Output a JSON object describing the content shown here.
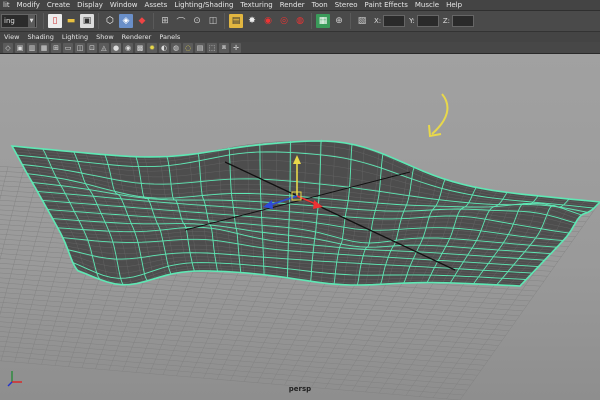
{
  "menubar": {
    "items": [
      "lit",
      "Modify",
      "Create",
      "Display",
      "Window",
      "Assets",
      "Lighting/Shading",
      "Texturing",
      "Render",
      "Toon",
      "Stereo",
      "Paint Effects",
      "Muscle",
      "Help"
    ]
  },
  "shelf": {
    "mode_value": "ing",
    "axis_labels": [
      "X:",
      "Y:",
      "Z:"
    ]
  },
  "panel_menu": {
    "items": [
      "View",
      "Shading",
      "Lighting",
      "Show",
      "Renderer",
      "Panels"
    ]
  },
  "viewport": {
    "camera_label": "persp",
    "background_color": "#9e9e9e",
    "wireframe_color": "#5ee8b4",
    "surface_color": "#4a4a4a",
    "annotation_arrow_color": "#e8d84a"
  },
  "icons": {
    "menubar": [],
    "shelf": [
      "new-scene-icon",
      "open-scene-icon",
      "save-scene-icon",
      "select-by-hierarchy-icon",
      "select-object-icon",
      "select-component-icon",
      "snap-grid-icon",
      "snap-curve-icon",
      "snap-point-icon",
      "snap-view-plane-icon",
      "history-icon",
      "render-icon",
      "ipr-render-icon",
      "render-settings-icon",
      "attribute-editor-icon",
      "tool-settings-icon",
      "channel-box-icon"
    ],
    "gizmo": [
      "move-manipulator-icon",
      "view-axis-icon"
    ]
  }
}
